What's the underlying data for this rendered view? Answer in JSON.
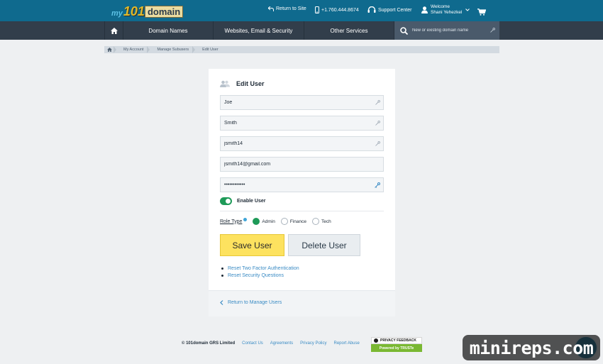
{
  "header": {
    "logo": {
      "my": "my",
      "num": "101",
      "domain": "domain"
    },
    "return_label": "Return to Site",
    "phone": "+1.760.444.8674",
    "support": "Support Center",
    "welcome_line1": "Welcome",
    "welcome_line2": "Shani Yehezkel"
  },
  "nav": {
    "items": [
      "Domain Names",
      "Websites, Email & Security",
      "Other Services"
    ],
    "search_placeholder": "New or existing domain name"
  },
  "breadcrumb": [
    "My Account",
    "Manage Subusers",
    "Edit User"
  ],
  "form": {
    "title": "Edit User",
    "first_name": "Joe",
    "last_name": "Smith",
    "username": "jsmith14",
    "email": "jsmith14@gmail.com",
    "password": "••••••••••••",
    "enable_label": "Enable User",
    "enabled": true,
    "role_label": "Role Type",
    "roles": [
      "Admin",
      "Finance",
      "Tech"
    ],
    "selected_role": "Admin",
    "save_label": "Save User",
    "delete_label": "Delete User",
    "links": [
      "Reset Two Factor Authentication",
      "Reset Security Questions"
    ],
    "back_label": "Return to Manage Users"
  },
  "footer": {
    "copyright": "© 101domain GRS Limited",
    "links": [
      "Contact Us",
      "Agreements",
      "Privacy Policy",
      "Report Abuse"
    ],
    "trust_top": "PRIVACY FEEDBACK",
    "trust_bottom": "Powered by TRUSTe"
  },
  "watermark": "minireps.com",
  "colors": {
    "topbar": "#0f6a8e",
    "nav": "#323e4b",
    "accent_green": "#1e9a58",
    "save_yellow": "#fde25f",
    "link_blue": "#3a8bc4"
  }
}
